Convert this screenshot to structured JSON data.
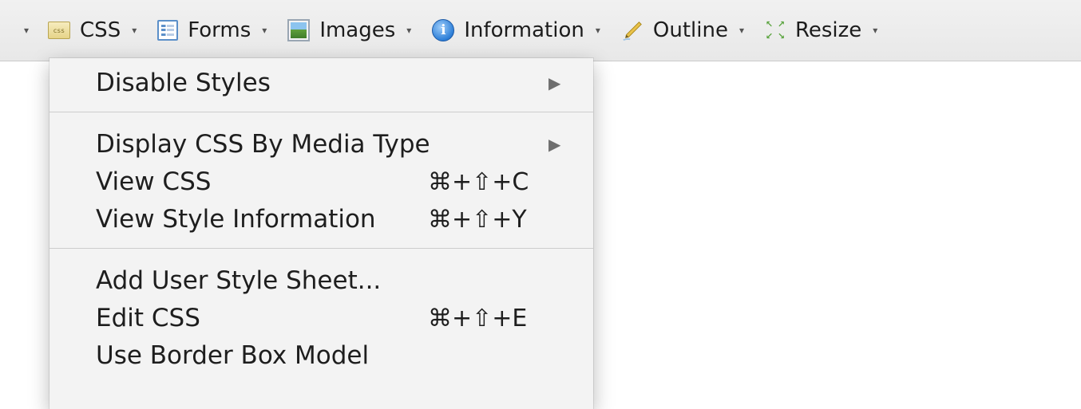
{
  "toolbar": {
    "items": [
      {
        "label": "CSS",
        "icon": "css-icon"
      },
      {
        "label": "Forms",
        "icon": "forms-icon"
      },
      {
        "label": "Images",
        "icon": "images-icon"
      },
      {
        "label": "Information",
        "icon": "information-icon"
      },
      {
        "label": "Outline",
        "icon": "outline-pencil-icon"
      },
      {
        "label": "Resize",
        "icon": "resize-arrows-icon"
      }
    ],
    "caret": "▾"
  },
  "menu": {
    "groups": [
      [
        {
          "label": "Disable Styles",
          "submenu": true,
          "shortcut": ""
        }
      ],
      [
        {
          "label": "Display CSS By Media Type",
          "submenu": true,
          "shortcut": ""
        },
        {
          "label": "View CSS",
          "submenu": false,
          "shortcut": "⌘+⇧+C"
        },
        {
          "label": "View Style Information",
          "submenu": false,
          "shortcut": "⌘+⇧+Y"
        }
      ],
      [
        {
          "label": "Add User Style Sheet...",
          "submenu": false,
          "shortcut": ""
        },
        {
          "label": "Edit CSS",
          "submenu": false,
          "shortcut": "⌘+⇧+E"
        },
        {
          "label": "Use Border Box Model",
          "submenu": false,
          "shortcut": ""
        }
      ]
    ],
    "submenu_arrow": "▶"
  },
  "colors": {
    "toolbar_bg": "#ececec",
    "menu_bg": "#f3f3f3",
    "separator": "#cdcdcd",
    "submenu_arrow": "#6e6e6e"
  }
}
